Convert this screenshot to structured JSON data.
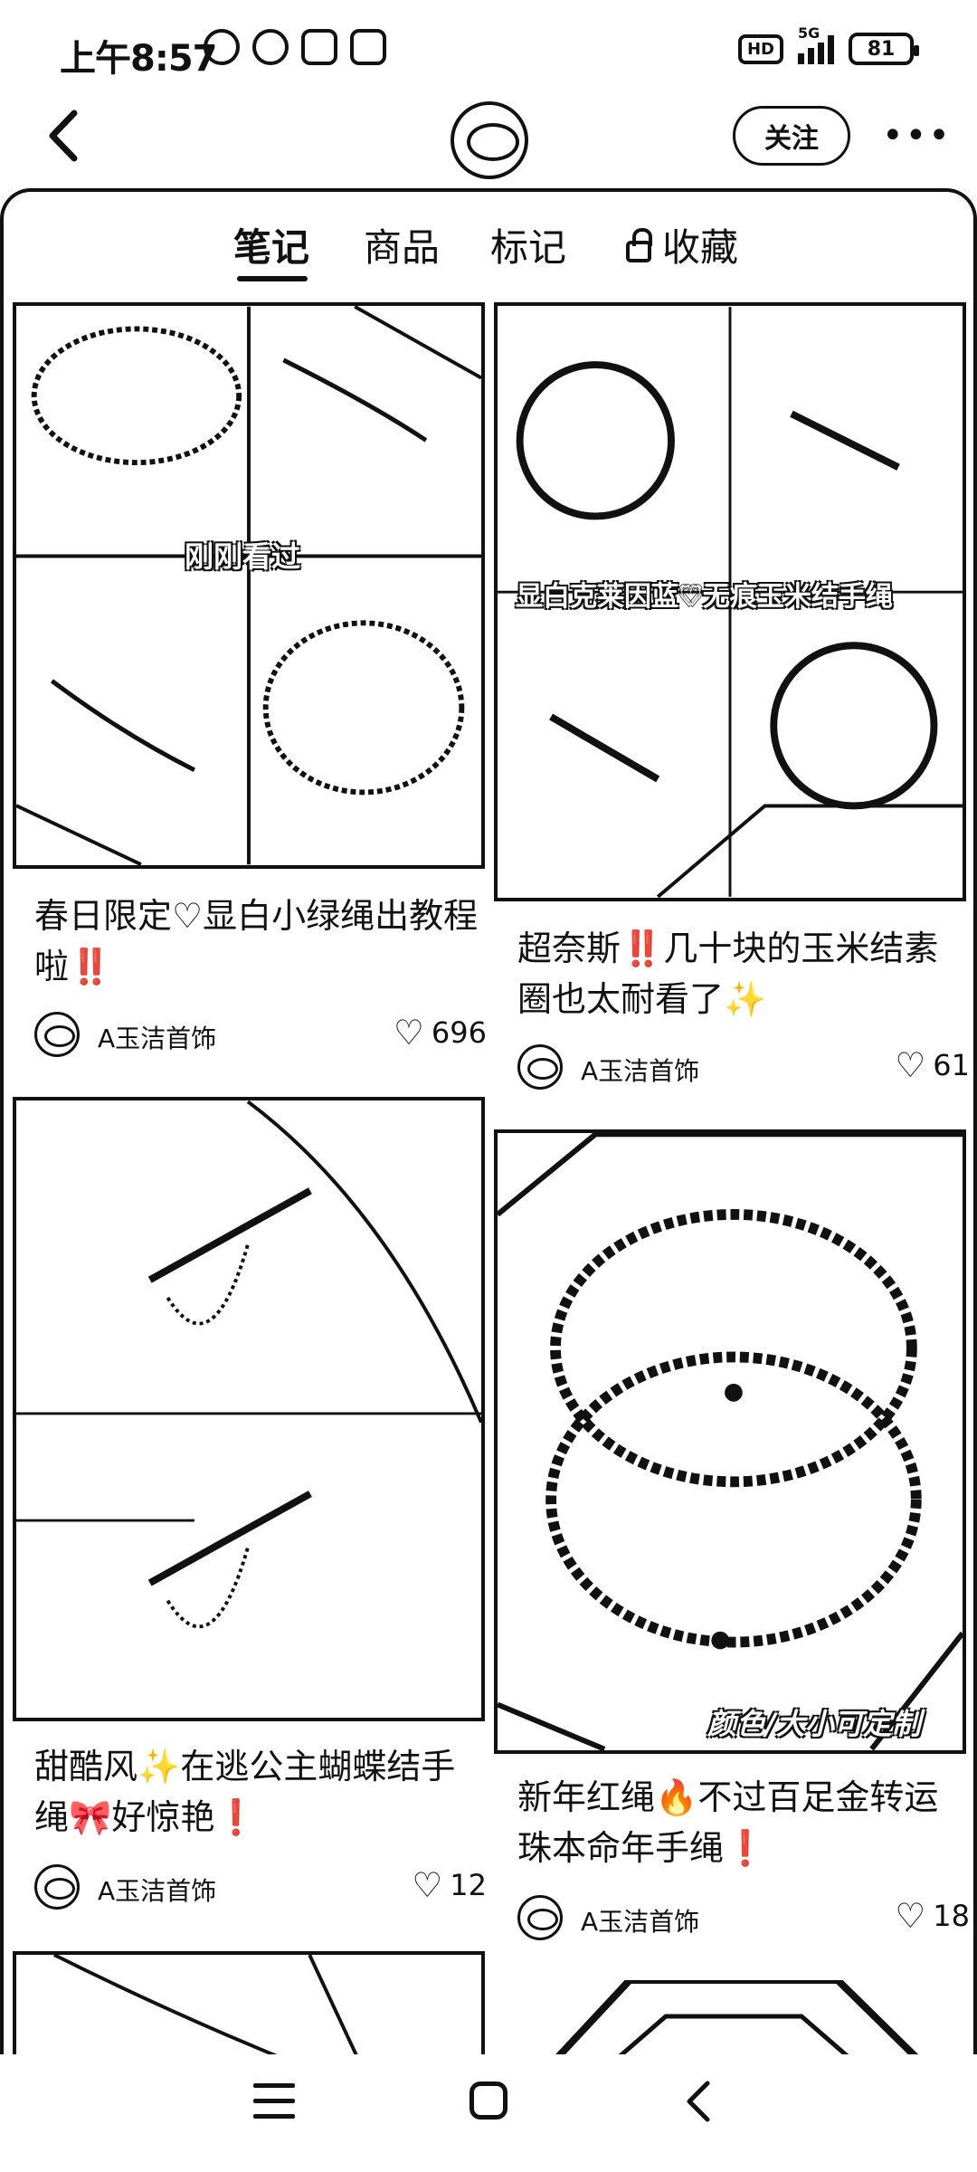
{
  "status_bar": {
    "time": "上午8:57",
    "hd": "HD",
    "network": "5G",
    "battery": "81"
  },
  "header": {
    "follow_label": "关注",
    "more_label": "•••"
  },
  "tabs": [
    {
      "label": "笔记",
      "active": true
    },
    {
      "label": "商品",
      "active": false
    },
    {
      "label": "标记",
      "active": false
    },
    {
      "label": "收藏",
      "active": false,
      "locked": true
    }
  ],
  "cards": [
    {
      "overlay": "刚刚看过",
      "title": "春日限定♡显白小绿绳出教程啦‼️",
      "author": "A玉洁首饰",
      "likes": "696"
    },
    {
      "overlay": "显白克莱因蓝♡无痕玉米结手绳",
      "title": "超奈斯‼️几十块的玉米结素圈也太耐看了✨",
      "author": "A玉洁首饰",
      "likes": "61"
    },
    {
      "overlay": "",
      "title": "甜酷风✨在逃公主蝴蝶结手绳🎀好惊艳❗",
      "author": "A玉洁首饰",
      "likes": "12"
    },
    {
      "overlay": "颜色/大小可定制",
      "title": "新年红绳🔥不过百足金转运珠本命年手绳❗",
      "author": "A玉洁首饰",
      "likes": "18"
    }
  ],
  "icons": {
    "back": "chevron-left-icon",
    "like": "heart-outline-icon",
    "lock": "lock-icon",
    "nav_menu": "menu-icon",
    "nav_home": "home-square-icon",
    "nav_back": "back-icon"
  }
}
